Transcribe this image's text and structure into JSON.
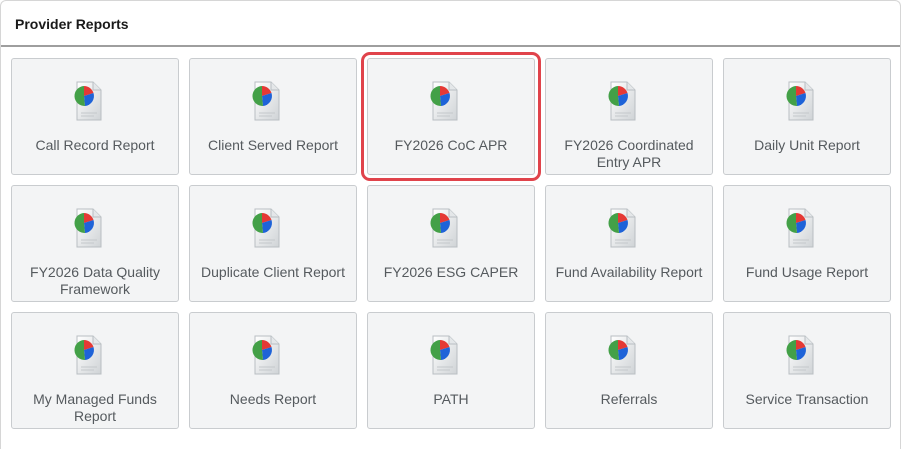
{
  "panel": {
    "title": "Provider Reports"
  },
  "reports": [
    {
      "label": "Call Record Report",
      "icon": "report-pie-chart-icon"
    },
    {
      "label": "Client Served Report",
      "icon": "report-pie-chart-icon"
    },
    {
      "label": "FY2026 CoC APR",
      "icon": "report-pie-chart-icon",
      "selected": true
    },
    {
      "label": "FY2026 Coordinated Entry APR",
      "icon": "report-pie-chart-icon"
    },
    {
      "label": "Daily Unit Report",
      "icon": "report-pie-chart-icon"
    },
    {
      "label": "FY2026 Data Quality Framework",
      "icon": "report-pie-chart-icon"
    },
    {
      "label": "Duplicate Client Report",
      "icon": "report-pie-chart-icon"
    },
    {
      "label": "FY2026 ESG CAPER",
      "icon": "report-pie-chart-icon"
    },
    {
      "label": "Fund Availability Report",
      "icon": "report-pie-chart-icon"
    },
    {
      "label": "Fund Usage Report",
      "icon": "report-pie-chart-icon"
    },
    {
      "label": "My Managed Funds Report",
      "icon": "report-pie-chart-icon"
    },
    {
      "label": "Needs Report",
      "icon": "report-pie-chart-icon"
    },
    {
      "label": "PATH",
      "icon": "report-pie-chart-icon"
    },
    {
      "label": "Referrals",
      "icon": "report-pie-chart-icon"
    },
    {
      "label": "Service Transaction",
      "icon": "report-pie-chart-icon"
    }
  ],
  "colors": {
    "selection_outline": "#e0434b",
    "tile_background": "#f3f4f5",
    "tile_border": "#c9cccf",
    "pie_red": "#e53935",
    "pie_green": "#43a047",
    "pie_blue": "#1e63d8"
  }
}
